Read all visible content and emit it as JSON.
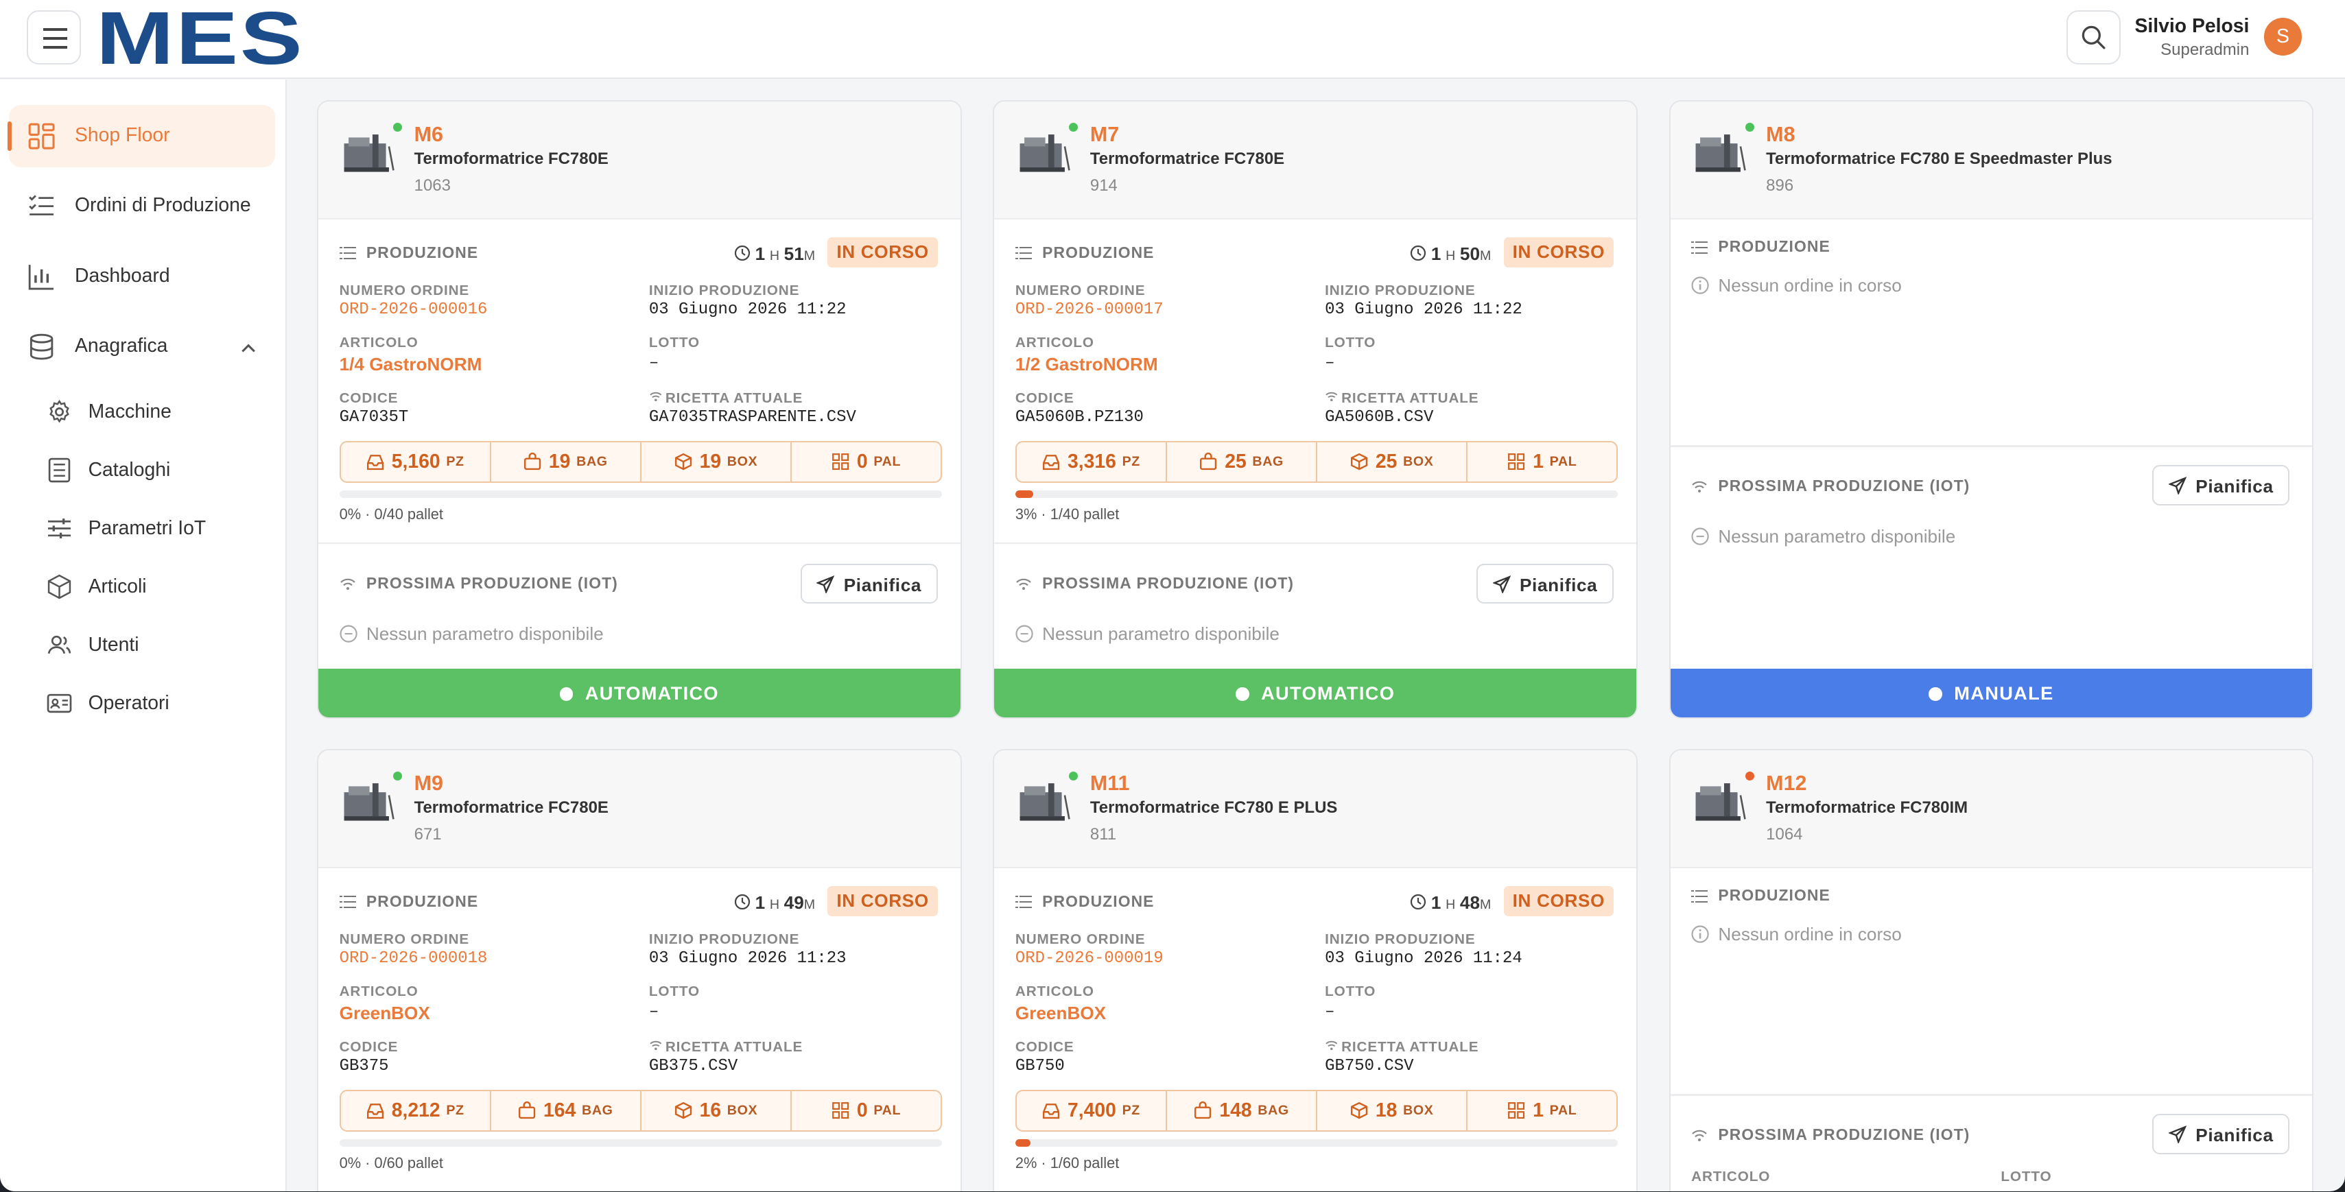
{
  "header": {
    "logo": "MES",
    "user_name": "Silvio Pelosi",
    "user_role": "Superadmin",
    "avatar_initial": "S"
  },
  "sidebar": {
    "items": [
      {
        "label": "Shop Floor",
        "icon": "grid-icon",
        "active": true
      },
      {
        "label": "Ordini di Produzione",
        "icon": "checklist-icon"
      },
      {
        "label": "Dashboard",
        "icon": "bar-chart-icon"
      },
      {
        "label": "Anagrafica",
        "icon": "database-icon",
        "expanded": true
      }
    ],
    "subitems": [
      {
        "label": "Macchine",
        "icon": "gear-icon"
      },
      {
        "label": "Cataloghi",
        "icon": "book-icon"
      },
      {
        "label": "Parametri IoT",
        "icon": "sliders-icon"
      },
      {
        "label": "Articoli",
        "icon": "box-icon"
      },
      {
        "label": "Utenti",
        "icon": "users-icon"
      },
      {
        "label": "Operatori",
        "icon": "id-card-icon"
      }
    ]
  },
  "labels": {
    "produzione": "PRODUZIONE",
    "in_corso": "IN CORSO",
    "numero_ordine": "NUMERO ORDINE",
    "inizio_produzione": "INIZIO PRODUZIONE",
    "articolo": "ARTICOLO",
    "lotto": "LOTTO",
    "codice": "CODICE",
    "ricetta_attuale": "RICETTA ATTUALE",
    "prossima_produzione": "PROSSIMA PRODUZIONE (IOT)",
    "pianifica": "Pianifica",
    "nessun_parametro": "Nessun parametro disponibile",
    "nessun_ordine": "Nessun ordine in corso",
    "unit_pz": "PZ",
    "unit_bag": "BAG",
    "unit_box": "BOX",
    "unit_pal": "PAL",
    "h": "H",
    "m": "M"
  },
  "colors": {
    "accent": "#ea7a3a",
    "automatico": "#5cc064",
    "manuale": "#4a7de8",
    "status_online": "#4cc35a",
    "status_offline": "#e8622b"
  },
  "machines": [
    {
      "code": "M6",
      "model": "Termoformatrice FC780E",
      "id": "1063",
      "status": "online",
      "has_order": true,
      "hours": "1",
      "minutes": "51",
      "order_number": "ORD-2026-000016",
      "start": "03 Giugno 2026 11:22",
      "article": "1/4 GastroNORM",
      "lot": "–",
      "code_value": "GA7035T",
      "recipe": "GA7035TRASPARENTE.CSV",
      "pz": "5,160",
      "bag": "19",
      "box": "19",
      "pal": "0",
      "progress": 0,
      "progress_text": "0% · 0/40 pallet",
      "mode": "AUTOMATICO"
    },
    {
      "code": "M7",
      "model": "Termoformatrice FC780E",
      "id": "914",
      "status": "online",
      "has_order": true,
      "hours": "1",
      "minutes": "50",
      "order_number": "ORD-2026-000017",
      "start": "03 Giugno 2026 11:22",
      "article": "1/2 GastroNORM",
      "lot": "–",
      "code_value": "GA5060B.PZ130",
      "recipe": "GA5060B.CSV",
      "pz": "3,316",
      "bag": "25",
      "box": "25",
      "pal": "1",
      "progress": 3,
      "progress_text": "3% · 1/40 pallet",
      "mode": "AUTOMATICO"
    },
    {
      "code": "M8",
      "model": "Termoformatrice FC780 E Speedmaster Plus",
      "id": "896",
      "status": "online",
      "has_order": false,
      "mode": "MANUALE"
    },
    {
      "code": "M9",
      "model": "Termoformatrice FC780E",
      "id": "671",
      "status": "online",
      "has_order": true,
      "hours": "1",
      "minutes": "49",
      "order_number": "ORD-2026-000018",
      "start": "03 Giugno 2026 11:23",
      "article": "GreenBOX",
      "lot": "–",
      "code_value": "GB375",
      "recipe": "GB375.CSV",
      "pz": "8,212",
      "bag": "164",
      "box": "16",
      "pal": "0",
      "progress": 0,
      "progress_text": "0% · 0/60 pallet"
    },
    {
      "code": "M11",
      "model": "Termoformatrice FC780 E PLUS",
      "id": "811",
      "status": "online",
      "has_order": true,
      "hours": "1",
      "minutes": "48",
      "order_number": "ORD-2026-000019",
      "start": "03 Giugno 2026 11:24",
      "article": "GreenBOX",
      "lot": "–",
      "code_value": "GB750",
      "recipe": "GB750.CSV",
      "pz": "7,400",
      "bag": "148",
      "box": "18",
      "pal": "1",
      "progress": 2,
      "progress_text": "2% · 1/60 pallet"
    },
    {
      "code": "M12",
      "model": "Termoformatrice FC780IM",
      "id": "1064",
      "status": "offline",
      "has_order": false,
      "next_article_label": "ARTICOLO",
      "next_lot_label": "LOTTO"
    }
  ]
}
